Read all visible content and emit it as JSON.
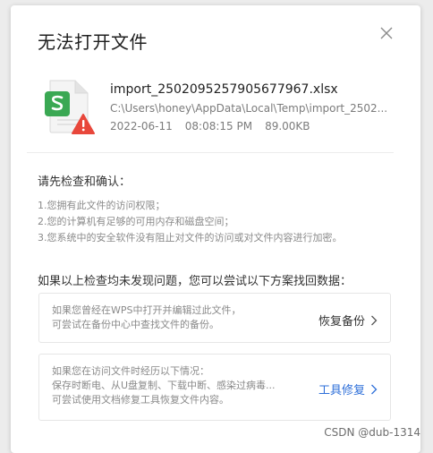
{
  "dialog": {
    "title": "无法打开文件",
    "close_icon": "close-icon"
  },
  "file": {
    "icon": "spreadsheet-file-warning-icon",
    "name": "import_2502095257905677967.xlsx",
    "path": "C:\\Users\\honey\\AppData\\Local\\Temp\\import_2502...",
    "date": "2022-06-11",
    "time": "08:08:15 PM",
    "size": "89.00KB"
  },
  "check": {
    "title": "请先检查和确认：",
    "items": [
      "1.您拥有此文件的访问权限；",
      "2.您的计算机有足够的可用内存和磁盘空间；",
      "3.您系统中的安全软件没有阻止对文件的访问或对文件内容进行加密。"
    ]
  },
  "recover": {
    "title": "如果以上检查均未发现问题，您可以尝试以下方案找回数据：",
    "options": [
      {
        "lines": [
          "如果您曾经在WPS中打开并编辑过此文件，",
          "可尝试在备份中心中查找文件的备份。"
        ],
        "action": "恢复备份"
      },
      {
        "lines": [
          "如果您在访问文件时经历以下情况：",
          "保存时断电、从U盘复制、下载中断、感染过病毒...",
          "可尝试使用文档修复工具恢复文件内容。"
        ],
        "action": "工具修复"
      }
    ]
  },
  "watermark": "CSDN @dub-1314",
  "colors": {
    "accent": "#2e6fd9",
    "spreadsheet_green": "#3aa853",
    "warning_red": "#e8473b"
  }
}
